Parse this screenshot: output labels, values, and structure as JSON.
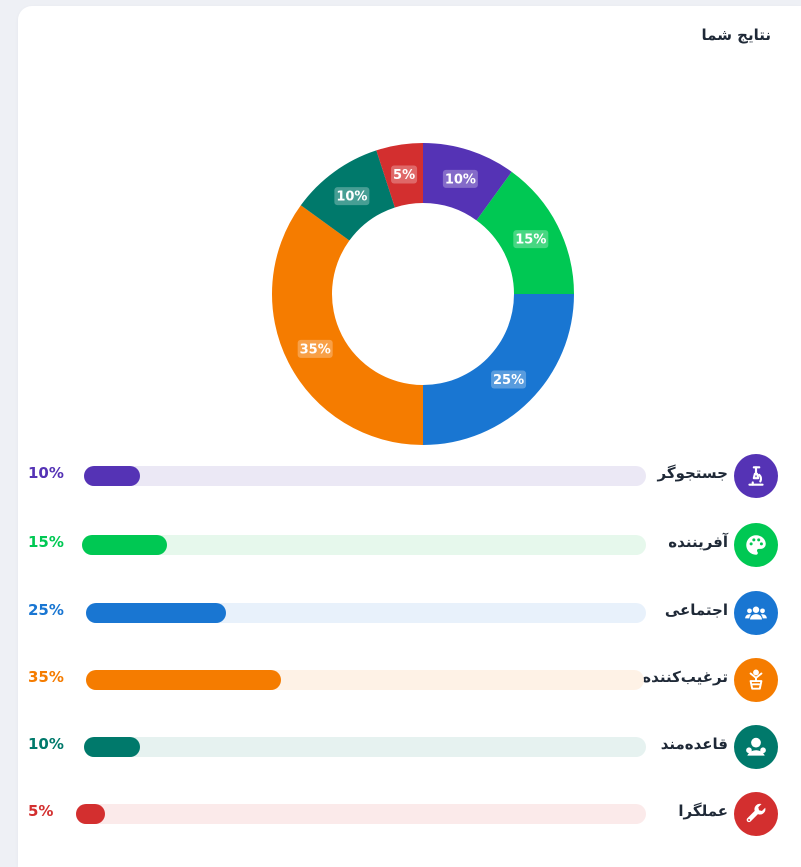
{
  "card": {
    "title": "نتایج شما"
  },
  "chart_data": {
    "type": "donut",
    "title": "نتایج شما",
    "categories": [
      "جستجوگر",
      "آفریننده",
      "اجتماعی",
      "ترغیب‌کننده",
      "قاعده‌مند",
      "عملگرا"
    ],
    "values": [
      10,
      15,
      25,
      35,
      10,
      5
    ],
    "data_labels": [
      "10%",
      "15%",
      "25%",
      "35%",
      "10%",
      "5%"
    ],
    "colors": [
      "#5533b5",
      "#00c853",
      "#1976d2",
      "#f57c00",
      "#00796b",
      "#d32f2f"
    ],
    "unit": "%"
  },
  "results": [
    {
      "label": "جستجوگر",
      "percent_text": "10%",
      "value": 10,
      "color": "#5533b5",
      "track": "#ebe8f5",
      "icon": "microscope-icon"
    },
    {
      "label": "آفریننده",
      "percent_text": "15%",
      "value": 15,
      "color": "#00c853",
      "track": "#e6f8ec",
      "icon": "palette-icon"
    },
    {
      "label": "اجتماعی",
      "percent_text": "25%",
      "value": 25,
      "color": "#1976d2",
      "track": "#e8f1fb",
      "icon": "people-icon"
    },
    {
      "label": "ترغیب‌کننده",
      "percent_text": "35%",
      "value": 35,
      "color": "#f57c00",
      "track": "#fef2e6",
      "icon": "speaker-icon"
    },
    {
      "label": "قاعده‌مند",
      "percent_text": "10%",
      "value": 10,
      "color": "#00796b",
      "track": "#e6f2f0",
      "icon": "organizer-icon"
    },
    {
      "label": "عملگرا",
      "percent_text": "5%",
      "value": 5,
      "color": "#d32f2f",
      "track": "#fbeaea",
      "icon": "wrench-icon"
    }
  ]
}
